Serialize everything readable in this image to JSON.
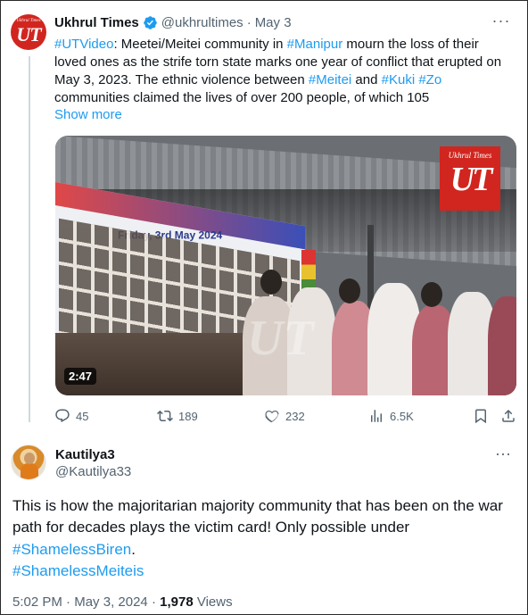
{
  "tweet": {
    "avatar": {
      "small_text": "Ukhrul Times",
      "logo": "UT"
    },
    "author_name": "Ukhrul Times",
    "verified_icon": "verified-badge-icon",
    "handle": "@ukhrultimes",
    "separator": "·",
    "date": "May 3",
    "text_segments": [
      {
        "t": "#UTVideo",
        "tag": true
      },
      {
        "t": ": Meetei/Meitei community in ",
        "tag": false
      },
      {
        "t": "#Manipur",
        "tag": true
      },
      {
        "t": " mourn the loss of their loved ones as the strife torn state marks one year of conflict that erupted on May 3, 2023. The ethnic violence between ",
        "tag": false
      },
      {
        "t": "#Meitei",
        "tag": true
      },
      {
        "t": " and ",
        "tag": false
      },
      {
        "t": "#Kuki",
        "tag": true
      },
      {
        "t": " ",
        "tag": false
      },
      {
        "t": "#Zo",
        "tag": true
      },
      {
        "t": " communities claimed the lives of over 200 people, of which 105",
        "tag": false
      }
    ],
    "show_more": "Show more",
    "video": {
      "duration": "2:47",
      "logo_small": "Ukhrul Times",
      "logo_big": "UT",
      "banner_text": "Friday, 3rd May 2024"
    },
    "actions": {
      "replies": "45",
      "reposts": "189",
      "likes": "232",
      "views": "6.5K"
    }
  },
  "reply": {
    "author_name": "Kautilya3",
    "handle": "@Kautilya33",
    "text": "This is how the majoritarian majority community that has been on the war path for decades plays the victim card! Only possible under",
    "tags": [
      "#ShamelessBiren",
      "#ShamelessMeiteis"
    ],
    "tag_suffix": ".",
    "time": "5:02 PM",
    "separator": "·",
    "date": "May 3, 2024",
    "separator2": "·",
    "views_count": "1,978",
    "views_label": "Views"
  },
  "colors": {
    "accent": "#1d9bf0",
    "muted": "#536471",
    "brand_red": "#d0261f"
  }
}
